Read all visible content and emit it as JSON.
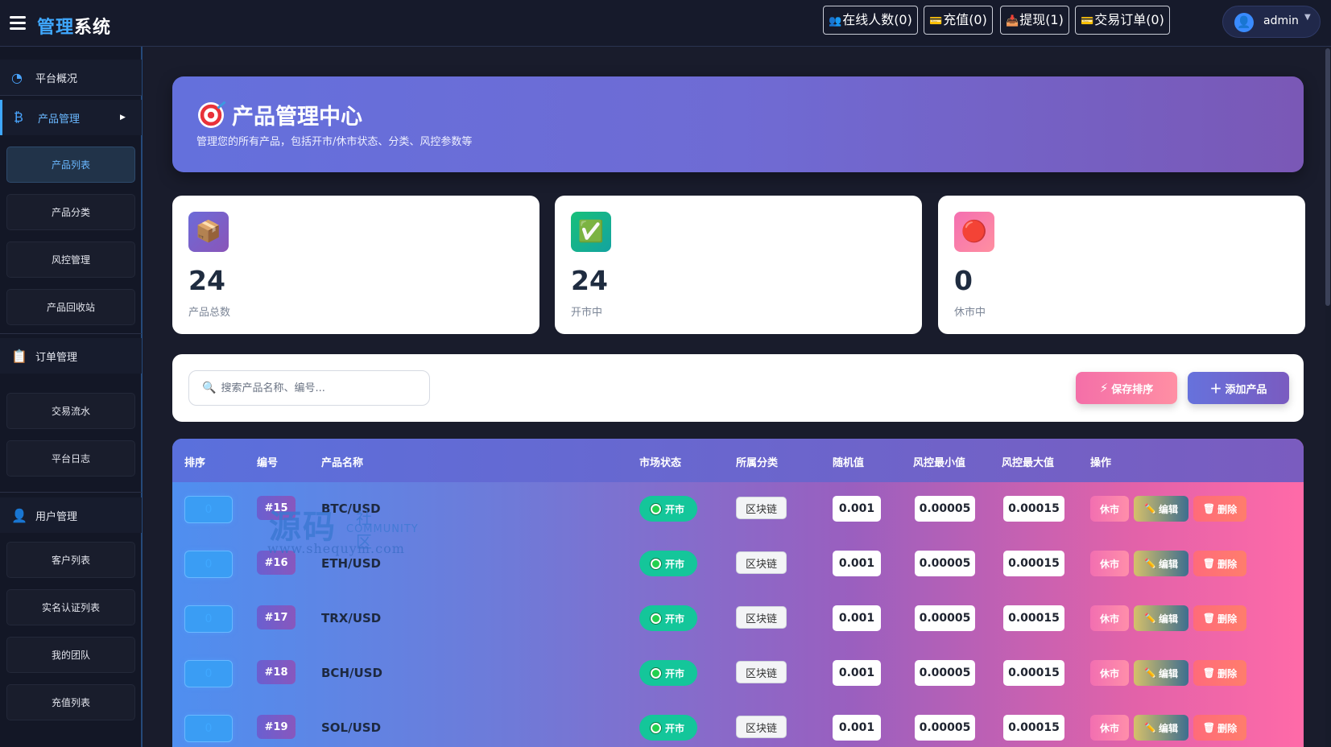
{
  "header": {
    "brand_part1": "管理",
    "brand_part2": "系统",
    "buttons": [
      {
        "icon": "users-icon",
        "glyph": "👥",
        "label": "在线人数(0)"
      },
      {
        "icon": "card-icon",
        "glyph": "💳",
        "label": "充值(0)"
      },
      {
        "icon": "download-icon",
        "glyph": "📥",
        "label": "提现(1)"
      },
      {
        "icon": "card-icon",
        "glyph": "💳",
        "label": "交易订单(0)"
      }
    ],
    "user": {
      "name": "admin",
      "avatar_glyph": "👤",
      "caret": "▼"
    }
  },
  "sidebar": {
    "groups": [
      {
        "icon": "dashboard-icon",
        "glyph": "◔",
        "label": "平台概况"
      },
      {
        "icon": "bitcoin-icon",
        "glyph": "₿",
        "label": "产品管理",
        "arrow": "▶"
      },
      {
        "icon": "orders-icon",
        "glyph": "📋",
        "label": "订单管理"
      },
      {
        "icon": "user-icon",
        "glyph": "👤",
        "label": "用户管理"
      }
    ],
    "product_items": [
      "产品列表",
      "产品分类",
      "风控管理",
      "产品回收站"
    ],
    "order_items": [
      "交易流水",
      "平台日志"
    ],
    "user_items": [
      "客户列表",
      "实名认证列表",
      "我的团队",
      "充值列表"
    ]
  },
  "banner": {
    "title": "产品管理中心",
    "subtitle": "管理您的所有产品，包括开市/休市状态、分类、风控参数等",
    "icon": "target-icon"
  },
  "stats": [
    {
      "icon": "box-icon",
      "glyph": "📦",
      "value": "24",
      "label": "产品总数",
      "color": "#7a5fd0"
    },
    {
      "icon": "check-icon",
      "glyph": "✅",
      "value": "24",
      "label": "开市中",
      "color": "#19c070"
    },
    {
      "icon": "red-circle-icon",
      "glyph": "🔴",
      "value": "0",
      "label": "休市中",
      "color": "#f46fa8"
    }
  ],
  "toolbar": {
    "search_placeholder": "搜索产品名称、编号...",
    "save_label": "保存排序",
    "add_label": "添加产品"
  },
  "table": {
    "headers": [
      "排序",
      "编号",
      "产品名称",
      "市场状态",
      "所属分类",
      "随机值",
      "风控最小值",
      "风控最大值",
      "操作"
    ],
    "rows": [
      {
        "sort": "0",
        "id": "#15",
        "name": "BTC/USD",
        "status": "开市",
        "category": "区块链",
        "random": "0.001",
        "min": "0.00005",
        "max": "0.00015"
      },
      {
        "sort": "0",
        "id": "#16",
        "name": "ETH/USD",
        "status": "开市",
        "category": "区块链",
        "random": "0.001",
        "min": "0.00005",
        "max": "0.00015"
      },
      {
        "sort": "0",
        "id": "#17",
        "name": "TRX/USD",
        "status": "开市",
        "category": "区块链",
        "random": "0.001",
        "min": "0.00005",
        "max": "0.00015"
      },
      {
        "sort": "0",
        "id": "#18",
        "name": "BCH/USD",
        "status": "开市",
        "category": "区块链",
        "random": "0.001",
        "min": "0.00005",
        "max": "0.00015"
      },
      {
        "sort": "0",
        "id": "#19",
        "name": "SOL/USD",
        "status": "开市",
        "category": "区块链",
        "random": "0.001",
        "min": "0.00005",
        "max": "0.00015"
      }
    ],
    "actions": {
      "rest": "休市",
      "edit": "编辑",
      "delete": "删除"
    }
  },
  "watermark": {
    "big": "源码",
    "small": "社区",
    "community": "COMMUNITY",
    "url": "www.shequym.com"
  }
}
